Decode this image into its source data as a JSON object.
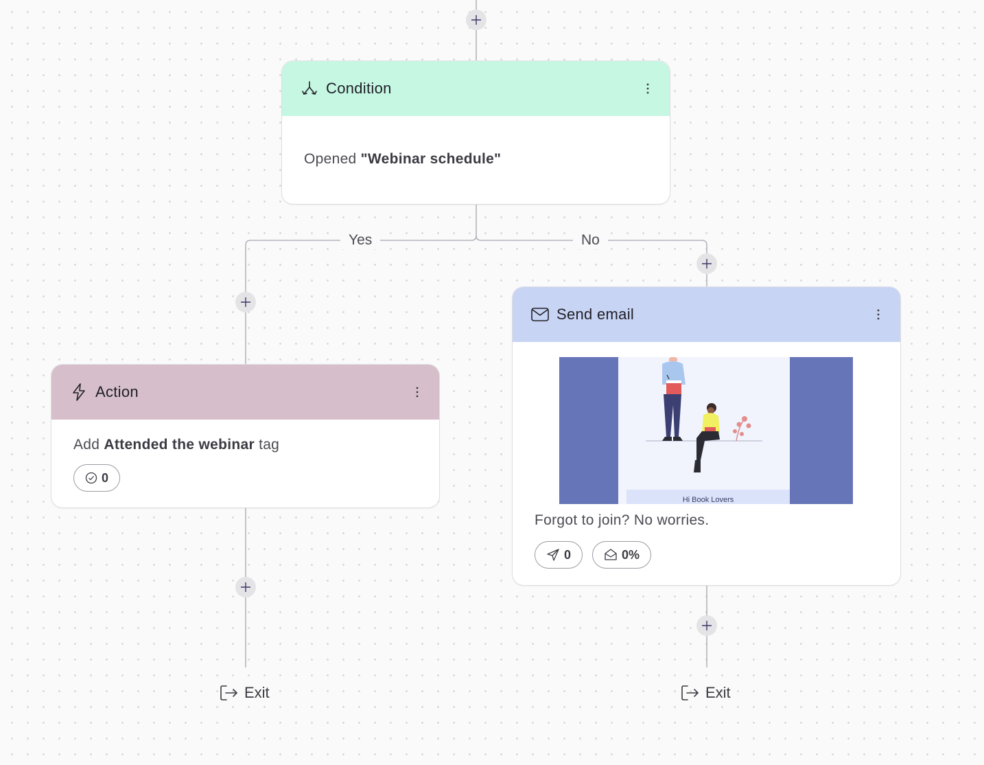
{
  "colors": {
    "condition_header": "#c6f7e3",
    "action_header": "#d6bfcb",
    "email_header": "#c8d4f4",
    "connector": "#b4b4bc",
    "email_side_panel": "#6674b8"
  },
  "condition": {
    "title": "Condition",
    "icon": "split-branch-icon",
    "desc_prefix": "Opened ",
    "desc_bold": "\"Webinar schedule\""
  },
  "branches": {
    "yes_label": "Yes",
    "no_label": "No"
  },
  "action": {
    "title": "Action",
    "icon": "lightning-icon",
    "desc_prefix": "Add ",
    "desc_bold": "Attended the webinar",
    "desc_suffix": " tag",
    "completed_count": "0"
  },
  "send_email": {
    "title": "Send email",
    "icon": "envelope-icon",
    "preview_text": "Hi Book Lovers",
    "subject": "Forgot to join? No worries.",
    "sent_count": "0",
    "open_rate": "0%"
  },
  "exit_left": {
    "label": "Exit"
  },
  "exit_right": {
    "label": "Exit"
  }
}
